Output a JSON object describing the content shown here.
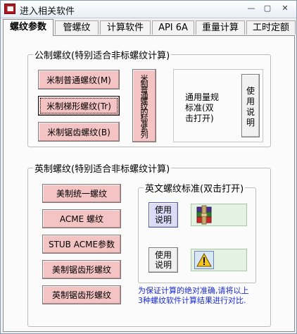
{
  "window": {
    "title": "进入相关软件",
    "minimize_glyph": "—",
    "maximize_glyph": "▢",
    "close_glyph": "✕"
  },
  "tabs": [
    {
      "label": "螺纹参数",
      "active": true
    },
    {
      "label": "管螺纹",
      "active": false
    },
    {
      "label": "计算软件",
      "active": false
    },
    {
      "label": "API 6A",
      "active": false
    },
    {
      "label": "重量计算",
      "active": false
    },
    {
      "label": "工时定额",
      "active": false
    }
  ],
  "metric": {
    "legend": "公制螺纹(特别适合非标螺纹计算)",
    "buttons": [
      "米制普通螺纹(M)",
      "米制梯形螺纹(Tr)",
      "米制锯齿螺纹(B)"
    ],
    "standard_series_button": [
      "米",
      "制",
      "普",
      "通",
      "螺",
      "纹",
      "的",
      "标",
      "准",
      "系",
      "列"
    ],
    "general_standard_text": [
      "通用量规",
      "标准(双",
      "击打开)"
    ],
    "instructions_button": [
      "使",
      "用",
      "说",
      "明"
    ]
  },
  "imperial": {
    "legend": "英制螺纹(特别适合非标螺纹计算)",
    "buttons": [
      "美制统一螺纹",
      "ACME 螺纹",
      "STUB ACME参数",
      "美制锯齿形螺纹",
      "英制锯齿形螺纹"
    ],
    "standard_group": {
      "legend": "英文螺纹标准(双击打开)",
      "instructions_1": [
        "使用",
        "说明"
      ],
      "instructions_2": [
        "使用",
        "说明"
      ]
    },
    "notice": [
      "为保证计算的绝对准确,请将以上",
      "3种螺纹软件计算结果进行对比."
    ]
  },
  "colors": {
    "button_pink": "#f4c3c3",
    "notice_blue": "#1a2bd8",
    "tile_green": "#e3f2e2"
  },
  "icons": [
    "app-book-icon",
    "winrar-archive-icon",
    "warning-icon"
  ]
}
